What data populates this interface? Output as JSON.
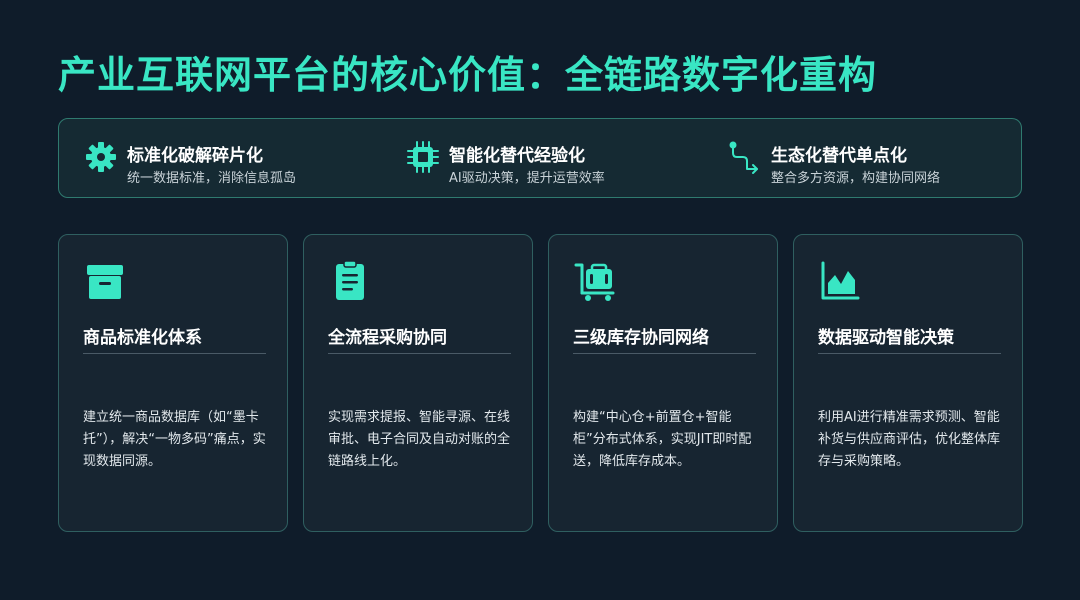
{
  "title": "产业互联网平台的核心价值：全链路数字化重构",
  "colors": {
    "accent": "#39e6c4",
    "background": "#0f1c2a",
    "card_background": "#172531",
    "card_border": "#2f5f60",
    "banner_border": "#2f7a6f"
  },
  "banner": {
    "items": [
      {
        "icon": "gear-icon",
        "title": "标准化破解碎片化",
        "subtitle": "统一数据标准，消除信息孤岛"
      },
      {
        "icon": "chip-icon",
        "title": "智能化替代经验化",
        "subtitle": "AI驱动决策，提升运营效率"
      },
      {
        "icon": "route-icon",
        "title": "生态化替代单点化",
        "subtitle": "整合多方资源，构建协同网络"
      }
    ]
  },
  "cards": [
    {
      "icon": "box-icon",
      "title": "商品标准化体系",
      "description": "建立统一商品数据库（如“墨卡托”），解决“一物多码”痛点，实现数据同源。"
    },
    {
      "icon": "clipboard-icon",
      "title": "全流程采购协同",
      "description": "实现需求提报、智能寻源、在线审批、电子合同及自动对账的全链路线上化。"
    },
    {
      "icon": "cart-icon",
      "title": "三级库存协同网络",
      "description": "构建“中心仓+前置仓+智能柜”分布式体系，实现JIT即时配送，降低库存成本。"
    },
    {
      "icon": "area-chart-icon",
      "title": "数据驱动智能决策",
      "description": "利用AI进行精准需求预测、智能补货与供应商评估，优化整体库存与采购策略。"
    }
  ]
}
